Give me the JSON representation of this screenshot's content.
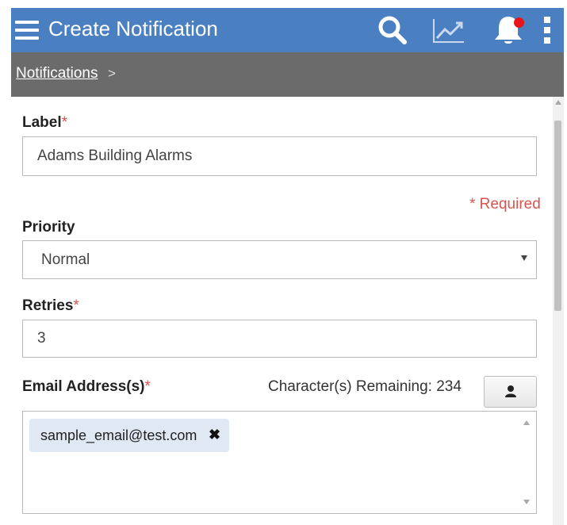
{
  "header": {
    "title": "Create Notification",
    "icons": [
      "menu-icon",
      "search-icon",
      "trend-chart-icon",
      "bell-icon",
      "kebab-menu-icon"
    ],
    "bg_color": "#4a7fc1",
    "notification_dot_color": "#e8141a"
  },
  "breadcrumb": {
    "link": "Notifications",
    "separator": ">"
  },
  "form": {
    "label": {
      "title": "Label",
      "required_mark": "*",
      "value": "Adams Building Alarms"
    },
    "required_note": "* Required",
    "priority": {
      "title": "Priority",
      "selected": "Normal"
    },
    "retries": {
      "title": "Retries",
      "required_mark": "*",
      "value": "3"
    },
    "email": {
      "title": "Email Address(s)",
      "required_mark": "*",
      "chars_remaining": "Character(s) Remaining: 234",
      "contact_icon": "person-icon",
      "chips": [
        {
          "text": "sample_email@test.com",
          "remove_icon": "close-icon"
        }
      ]
    },
    "required_color": "#d9534f"
  }
}
